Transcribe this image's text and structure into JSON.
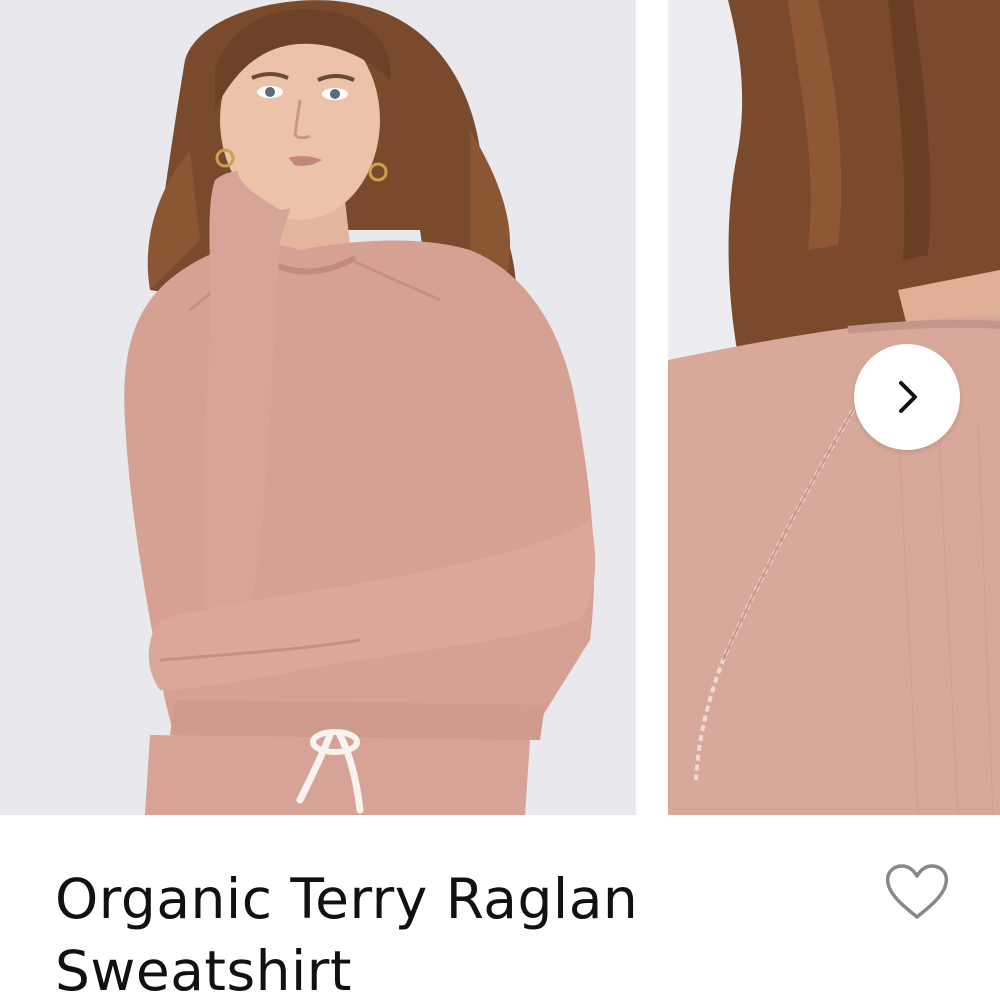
{
  "gallery": {
    "images": [
      {
        "alt": "",
        "icon": "model-front-photo"
      },
      {
        "alt": "",
        "icon": "shoulder-detail-photo"
      }
    ],
    "next_icon": "chevron-right-icon"
  },
  "product": {
    "title_line1": "Organic Terry Raglan",
    "title_line2": "Sweatshirt",
    "wishlist_icon": "heart-outline-icon"
  },
  "colors": {
    "sweatshirt": "#d5a295",
    "background": "#e9e9ee",
    "text": "#111111",
    "heart": "#888888"
  }
}
